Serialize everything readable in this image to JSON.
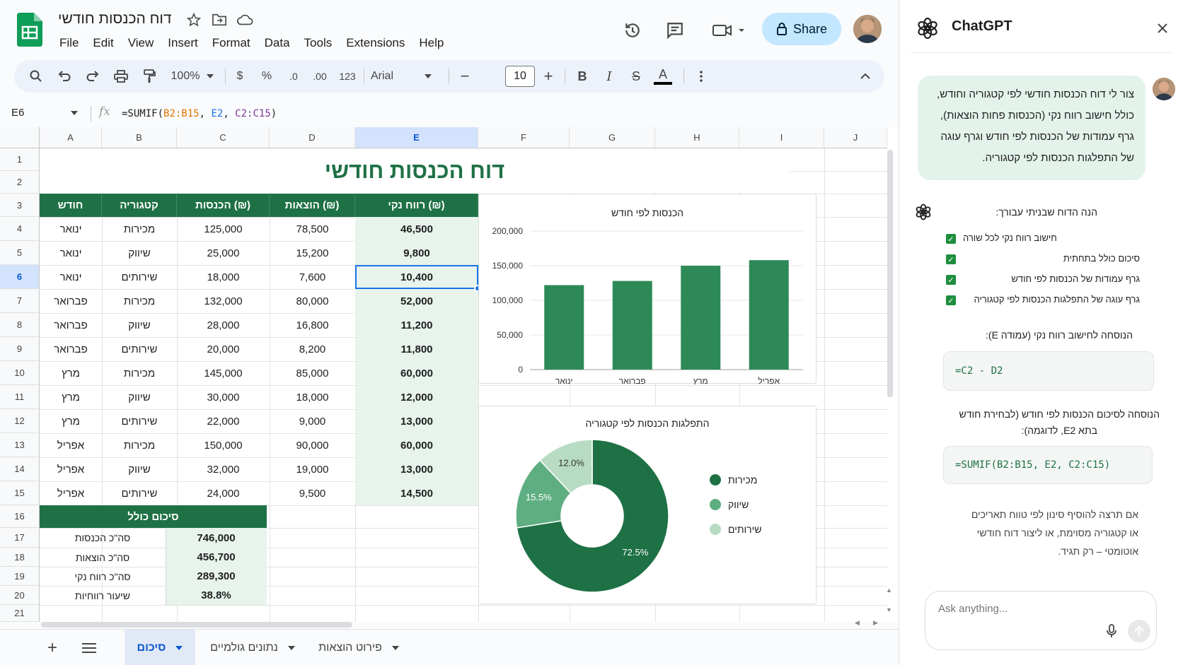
{
  "doc": {
    "title": "דוח הכנסות חודשי"
  },
  "menu": [
    "File",
    "Edit",
    "View",
    "Insert",
    "Format",
    "Data",
    "Tools",
    "Extensions",
    "Help"
  ],
  "share_label": "Share",
  "toolbar": {
    "zoom": "100%",
    "currency": "$",
    "percent": "%",
    "dec_down": ".0",
    "dec_up": ".00",
    "numfmt": "123",
    "font": "Arial",
    "font_size": "10",
    "bold": "B",
    "italic": "I",
    "strike": "S",
    "textcolor": "A"
  },
  "formula_bar": {
    "cell_ref": "E6",
    "fx": "fx",
    "formula_prefix": "=SUMIF(",
    "r1": "B2:B15",
    "comma1": ", ",
    "r2": "E2",
    "comma2": ", ",
    "r3": "C2:C15",
    "formula_suffix": ")"
  },
  "columns": [
    "A",
    "B",
    "C",
    "D",
    "E",
    "F",
    "G",
    "H",
    "I",
    "J"
  ],
  "rows": [
    "1",
    "2",
    "3",
    "4",
    "5",
    "6",
    "7",
    "8",
    "9",
    "10",
    "11",
    "12",
    "13",
    "14",
    "15",
    "16",
    "17",
    "18",
    "19",
    "20",
    "21"
  ],
  "sheet_title": "דוח הכנסות חודשי",
  "table": {
    "headers": [
      "חודש",
      "קטגוריה",
      "הכנסות (₪)",
      "הוצאות (₪)",
      "רווח נקי (₪)"
    ],
    "rows": [
      [
        "ינואר",
        "מכירות",
        "125,000",
        "78,500",
        "46,500"
      ],
      [
        "ינואר",
        "שיווק",
        "25,000",
        "15,200",
        "9,800"
      ],
      [
        "ינואר",
        "שירותים",
        "18,000",
        "7,600",
        "10,400"
      ],
      [
        "פברואר",
        "מכירות",
        "132,000",
        "80,000",
        "52,000"
      ],
      [
        "פברואר",
        "שיווק",
        "28,000",
        "16,800",
        "11,200"
      ],
      [
        "פברואר",
        "שירותים",
        "20,000",
        "8,200",
        "11,800"
      ],
      [
        "מרץ",
        "מכירות",
        "145,000",
        "85,000",
        "60,000"
      ],
      [
        "מרץ",
        "שיווק",
        "30,000",
        "18,000",
        "12,000"
      ],
      [
        "מרץ",
        "שירותים",
        "22,000",
        "9,000",
        "13,000"
      ],
      [
        "אפריל",
        "מכירות",
        "150,000",
        "90,000",
        "60,000"
      ],
      [
        "אפריל",
        "שיווק",
        "32,000",
        "19,000",
        "13,000"
      ],
      [
        "אפריל",
        "שירותים",
        "24,000",
        "9,500",
        "14,500"
      ]
    ]
  },
  "summary": {
    "header": "סיכום כולל",
    "rows": [
      [
        "סה\"כ הכנסות",
        "746,000"
      ],
      [
        "סה\"כ הוצאות",
        "456,700"
      ],
      [
        "סה\"כ רווח נקי",
        "289,300"
      ],
      [
        "שיעור רווחיות",
        "38.8%"
      ]
    ]
  },
  "chart_data": [
    {
      "type": "bar",
      "title": "הכנסות לפי חודש",
      "categories": [
        "ינואר",
        "פברואר",
        "מרץ",
        "אפריל"
      ],
      "values": [
        122000,
        128000,
        150000,
        158000
      ],
      "ylim": [
        0,
        200000
      ],
      "yticks": [
        "200,000",
        "150,000",
        "100,000",
        "50,000",
        "0"
      ],
      "grid": true,
      "color": "#2d8a57"
    },
    {
      "type": "pie",
      "title": "התפלגות הכנסות לפי קטגוריה",
      "categories": [
        "מכירות",
        "שיווק",
        "שירותים"
      ],
      "values": [
        72.5,
        15.5,
        12.0
      ],
      "labels": [
        "72.5%",
        "15.5%",
        "12.0%"
      ],
      "colors": [
        "#1e7145",
        "#5fae81",
        "#b7dcc3"
      ],
      "legend": "right",
      "donut": true
    }
  ],
  "tabs": [
    {
      "label": "סיכום",
      "active": true
    },
    {
      "label": "נתונים גולמיים",
      "active": false
    },
    {
      "label": "פירוט הוצאות",
      "active": false
    }
  ],
  "gpt": {
    "title": "ChatGPT",
    "user_message": [
      "צור לי דוח הכנסות חודשי לפי קטגוריה וחודש,",
      "כולל חישוב רווח נקי (הכנסות פחות הוצאות),",
      "גרף עמודות של הכנסות לפי חודש וגרף עוגה",
      "של התפלגות הכנסות לפי קטגוריה."
    ],
    "intro": "הנה הדוח שבניתי עבורך:",
    "checks": [
      "חישוב רווח נקי לכל שורה",
      "סיכום כולל בתחתית",
      "גרף עמודות של הכנסות לפי חודש",
      "גרף עוגה של התפלגות הכנסות לפי קטגוריה"
    ],
    "formula_label1": "הנוסחה לחישוב רווח נקי (עמודה E):",
    "code1": "=C2 - D2",
    "formula_label2a": "הנוסחה לסיכום הכנסות לפי חודש (לבחירת חודש",
    "formula_label2b": "בתא E2, לדוגמה):",
    "code2": "=SUMIF(B2:B15, E2, C2:C15)",
    "outro": [
      "אם תרצה להוסיף סינון לפי טווח תאריכים",
      "או קטגוריה מסוימת, או ליצור דוח חודשי",
      "אוטומטי – רק תגיד."
    ],
    "placeholder": "Ask anything..."
  },
  "colors": {
    "accent_green": "#1e7145",
    "light_green": "#e8f3ec",
    "selection_blue": "#1a73e8",
    "share_bg": "#c2e7ff"
  }
}
